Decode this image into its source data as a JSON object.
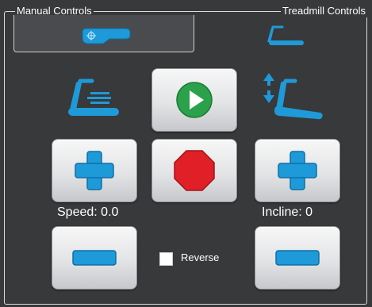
{
  "frame": {
    "manual_title": "Manual Controls",
    "treadmill_title": "Treadmill Controls"
  },
  "tabs": {
    "manual": {
      "icon": "manual-control-icon",
      "selected": true
    },
    "treadmill": {
      "icon": "treadmill-icon",
      "selected": false
    }
  },
  "icons": {
    "speed": "treadmill-speed-icon",
    "incline": "treadmill-incline-icon"
  },
  "buttons": {
    "start": {
      "icon": "play-icon"
    },
    "stop": {
      "icon": "stop-icon"
    },
    "speed_up": {
      "icon": "plus-icon"
    },
    "speed_down": {
      "icon": "minus-icon"
    },
    "incline_up": {
      "icon": "plus-icon"
    },
    "incline_down": {
      "icon": "minus-icon"
    }
  },
  "speed": {
    "label": "Speed:",
    "value": "0.0"
  },
  "incline": {
    "label": "Incline:",
    "value": "0"
  },
  "reverse": {
    "label": "Reverse",
    "checked": false
  },
  "colors": {
    "accent": "#1e9ad8",
    "play": "#2aa14a",
    "stop": "#e01f26",
    "background": "#38393b"
  }
}
